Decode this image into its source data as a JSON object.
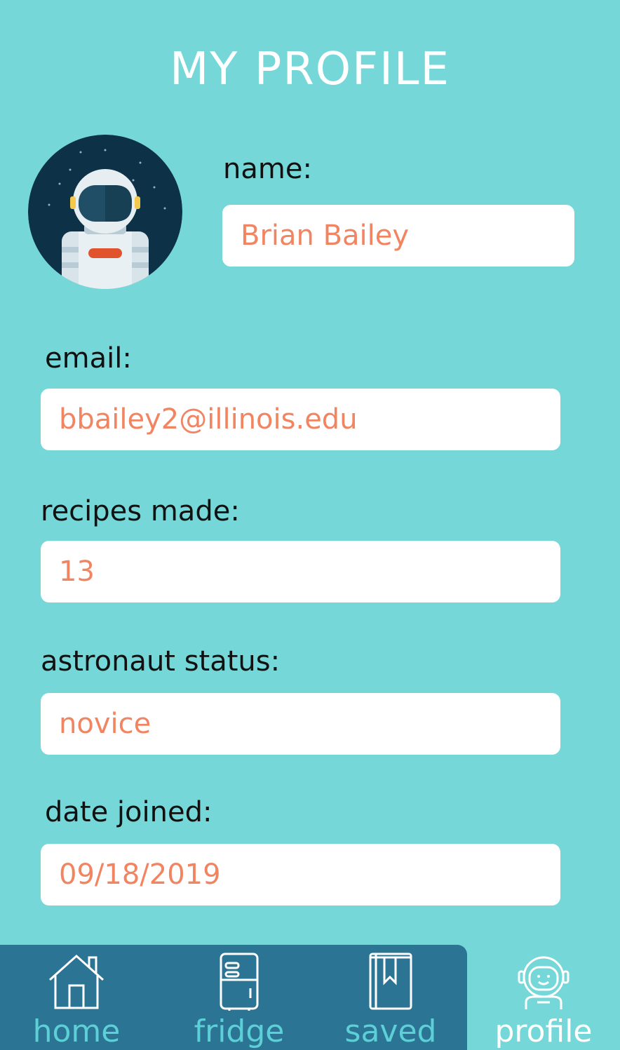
{
  "header": {
    "title": "MY PROFILE"
  },
  "profile": {
    "name_label": "name:",
    "name_value": "Brian Bailey",
    "email_label": "email:",
    "email_value": "bbailey2@illinois.edu",
    "recipes_label": "recipes made:",
    "recipes_value": "13",
    "status_label": "astronaut status:",
    "status_value": "novice",
    "joined_label": "date joined:",
    "joined_value": "09/18/2019"
  },
  "nav": {
    "items": [
      {
        "label": "home",
        "icon": "house-icon"
      },
      {
        "label": "fridge",
        "icon": "fridge-icon"
      },
      {
        "label": "saved",
        "icon": "bookmark-book-icon"
      },
      {
        "label": "profile",
        "icon": "astronaut-icon",
        "active": true
      }
    ]
  },
  "colors": {
    "background": "#76d7d8",
    "value_text": "#f28561",
    "nav_background": "#2b7494",
    "nav_inactive_text": "#5cd0d6",
    "nav_active_text": "#ffffff"
  }
}
